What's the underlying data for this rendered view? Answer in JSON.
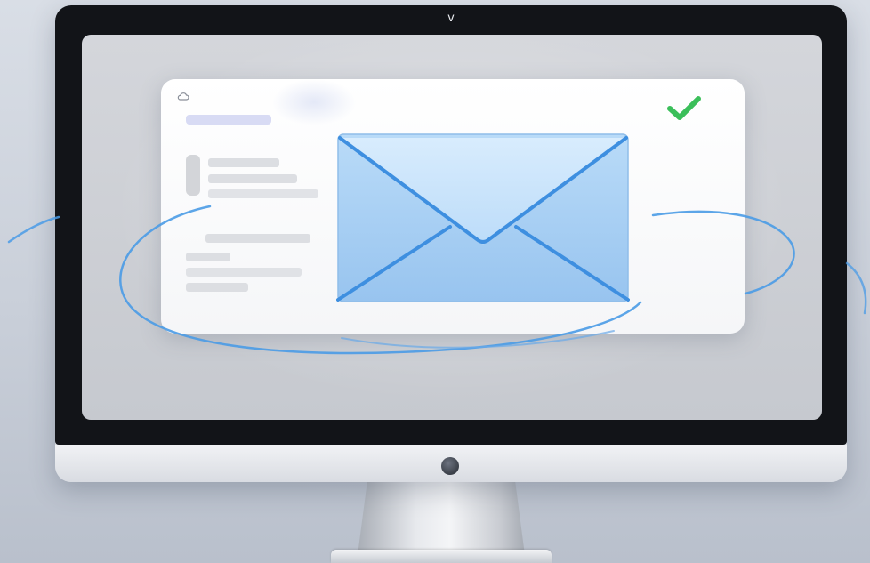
{
  "monitor": {
    "camera_glyph": "v",
    "camera_icon": "chevron-down-icon",
    "power_icon": "power-button-icon"
  },
  "email_window": {
    "header_icon": "cloud-icon",
    "status_icon": "check-icon",
    "status_color": "#3bbf5a",
    "content_icon": "envelope-icon"
  },
  "colors": {
    "envelope_fill": "#a8cff3",
    "envelope_flap": "#c9e3fb",
    "envelope_lines": "#3e8fe0",
    "swirl": "#4a9be6",
    "accent_bar": "#d8dbf4"
  }
}
